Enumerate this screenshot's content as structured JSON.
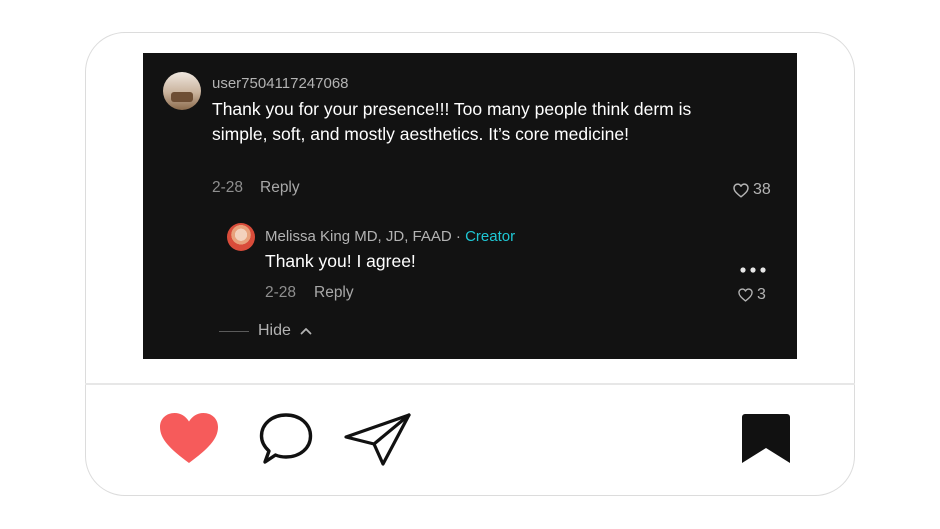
{
  "comment": {
    "username": "user7504117247068",
    "text": "Thank you for your presence!!! Too many people think derm is simple, soft, and mostly aesthetics. It’s core medicine!",
    "date": "2-28",
    "reply_label": "Reply",
    "like_count": "38"
  },
  "reply": {
    "author": "Melissa King MD, JD, FAAD",
    "separator": " · ",
    "creator_badge": "Creator",
    "text": "Thank you! I agree!",
    "date": "2-28",
    "reply_label": "Reply",
    "like_count": "3"
  },
  "thread": {
    "hide_label": "Hide"
  },
  "action_bar": {
    "icons": [
      "heart-icon",
      "comment-icon",
      "share-icon",
      "bookmark-icon"
    ],
    "heart_color": "#f65b5b",
    "liked": true
  },
  "colors": {
    "accent": "#1fc7d4",
    "background": "#121212"
  }
}
